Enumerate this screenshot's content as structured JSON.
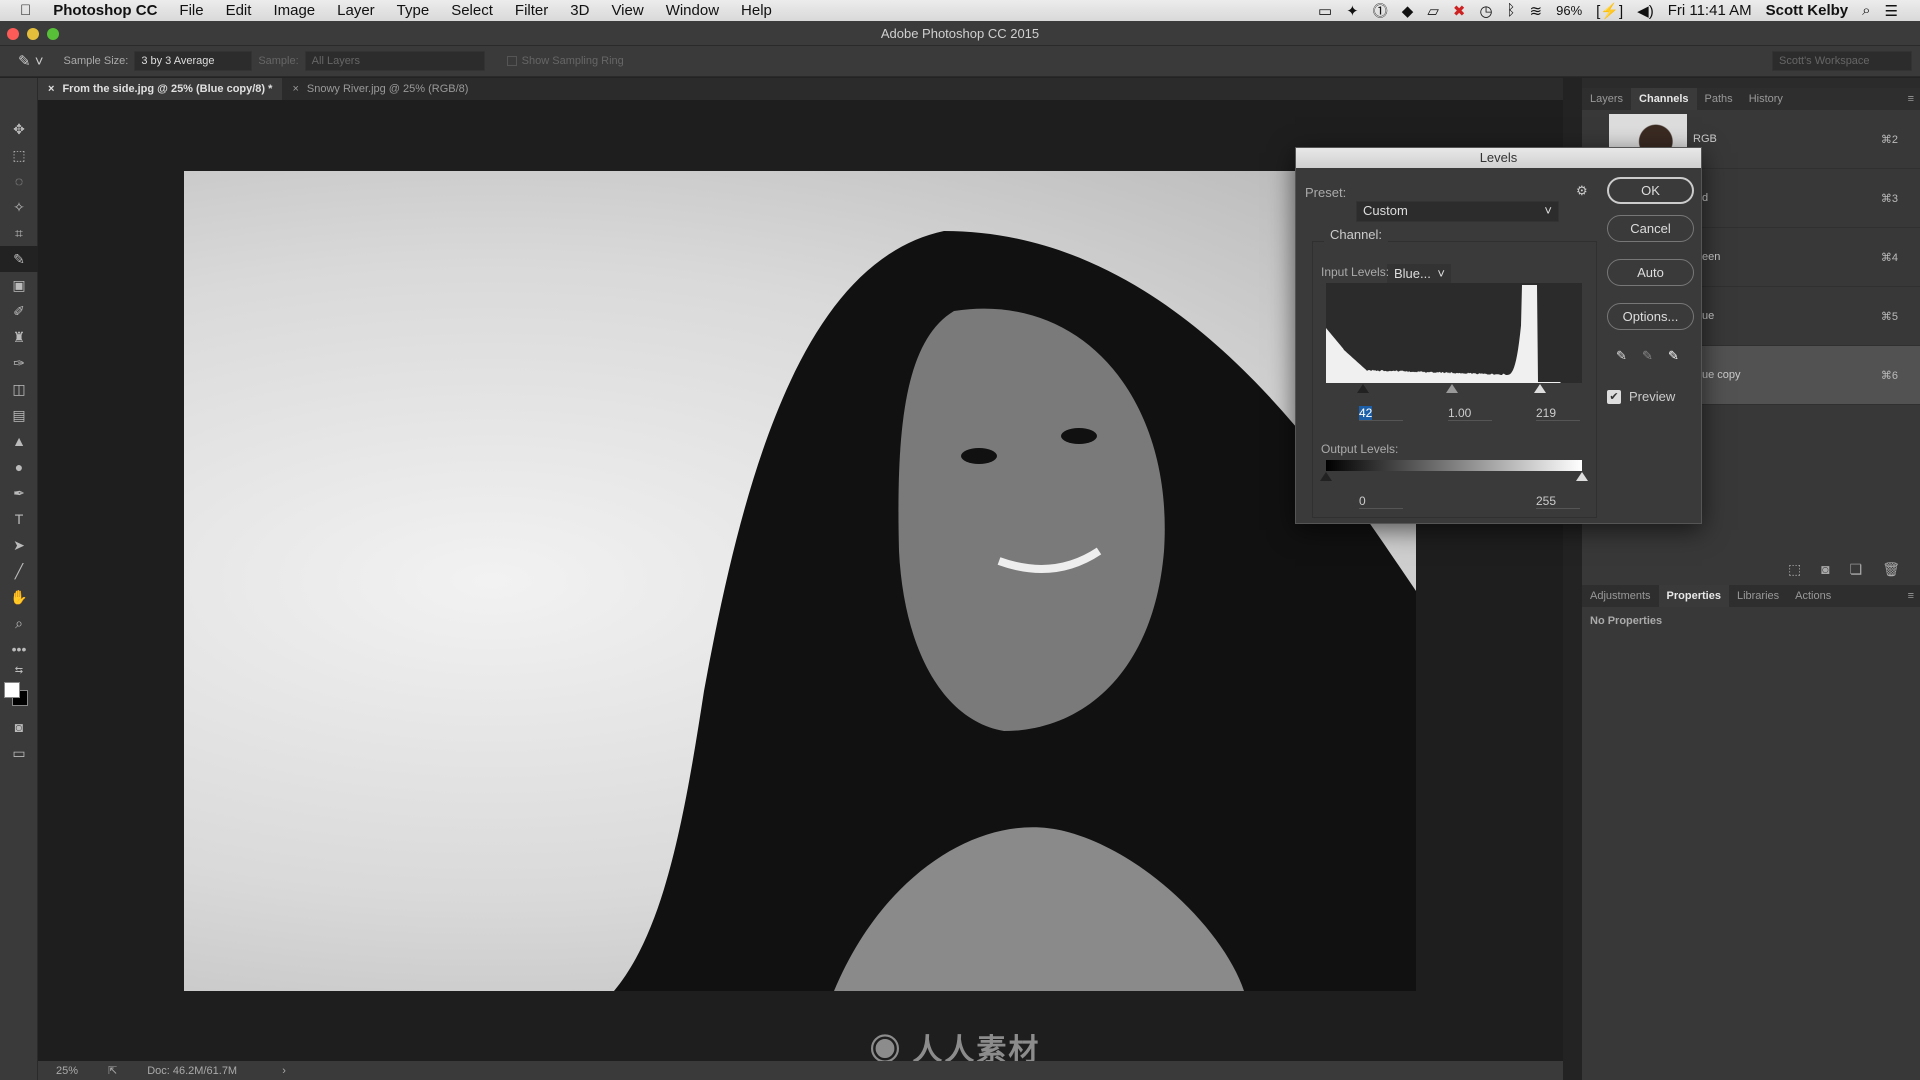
{
  "menubar": {
    "app": "Photoshop CC",
    "items": [
      "File",
      "Edit",
      "Image",
      "Layer",
      "Type",
      "Select",
      "Filter",
      "3D",
      "View",
      "Window",
      "Help"
    ],
    "battery": "96%",
    "clock": "Fri 11:41 AM",
    "user": "Scott Kelby"
  },
  "window": {
    "title": "Adobe Photoshop CC 2015"
  },
  "options": {
    "sample_size_label": "Sample Size:",
    "sample_size_value": "3 by 3 Average",
    "sample_label": "Sample:",
    "sample_value": "All Layers",
    "sampling_ring": "Show Sampling Ring",
    "workspace": "Scott's Workspace"
  },
  "tabs": [
    {
      "label": "From the side.jpg @ 25% (Blue copy/8) *",
      "active": true
    },
    {
      "label": "Snowy River.jpg @ 25% (RGB/8)",
      "active": false
    }
  ],
  "status": {
    "zoom": "25%",
    "doc": "Doc: 46.2M/61.7M"
  },
  "channels_panel": {
    "tabs": [
      "Layers",
      "Channels",
      "Paths",
      "History"
    ],
    "active_tab": "Channels",
    "rows": [
      {
        "name": "RGB",
        "key": "⌘2"
      },
      {
        "name": "d",
        "key": "⌘3"
      },
      {
        "name": "een",
        "key": "⌘4"
      },
      {
        "name": "ue",
        "key": "⌘5"
      },
      {
        "name": "ue copy",
        "key": "⌘6",
        "selected": true
      }
    ]
  },
  "properties_panel": {
    "tabs": [
      "Adjustments",
      "Properties",
      "Libraries",
      "Actions"
    ],
    "active_tab": "Properties",
    "text": "No Properties"
  },
  "levels": {
    "title": "Levels",
    "preset_label": "Preset:",
    "preset": "Custom",
    "channel_label": "Channel:",
    "channel": "Blue...",
    "input_label": "Input Levels:",
    "input_black": "42",
    "input_gamma": "1.00",
    "input_white": "219",
    "output_label": "Output Levels:",
    "output_black": "0",
    "output_white": "255",
    "buttons": {
      "ok": "OK",
      "cancel": "Cancel",
      "auto": "Auto",
      "options": "Options..."
    },
    "preview_label": "Preview",
    "preview_checked": true
  },
  "watermark": "人人素材"
}
